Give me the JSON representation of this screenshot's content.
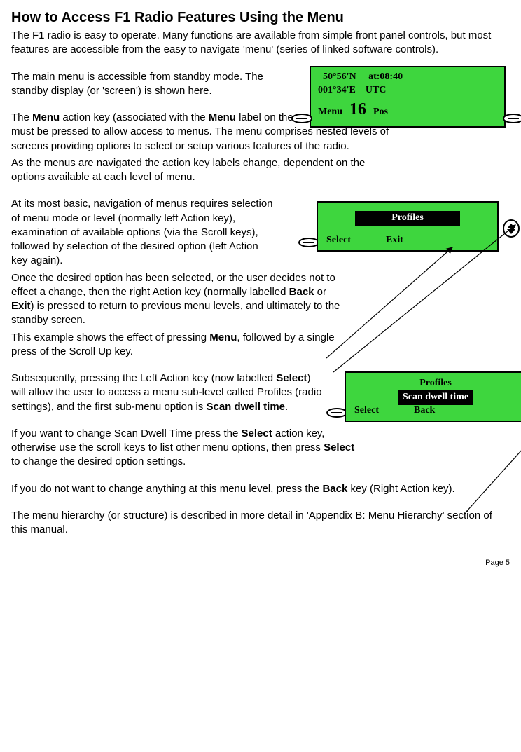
{
  "title": "How to Access F1 Radio Features Using the Menu",
  "intro": "The F1 radio is easy to operate. Many functions are available from simple front panel controls, but most features are accessible from the easy to navigate 'menu' (series of linked software controls).",
  "p1": "The main menu is accessible from standby mode. The standby display (or 'screen') is shown here.",
  "p2a": "The ",
  "p2b_bold": "Menu",
  "p2c": " action key (associated with the ",
  "p2d_bold": "Menu",
  "p2e": " label on the standby screen) must be pressed to allow access to menus. The menu comprises nested levels of screens providing options to select or setup various features of the radio.",
  "p3": "As the menus are navigated the action key labels change, dependent on the options available at each level of menu.",
  "p4": "At its most basic, navigation of menus requires selection of menu mode or level (normally left Action key), examination of available options (via the Scroll keys), followed by selection of the desired option (left Action key again).",
  "p5a": "Once the desired option has been selected, or the user decides not to effect a change, then the right Action key (normally labelled ",
  "p5b_bold": "Back",
  "p5c": " or ",
  "p5d_bold": "Exit",
  "p5e": ") is pressed to return to previous menu levels, and ultimately to the standby screen.",
  "p6a": "This example shows the effect of pressing ",
  "p6b_bold": "Menu",
  "p6c": ", followed by a single press of the Scroll Up key.",
  "p7a": "Subsequently, pressing the Left Action key (now labelled ",
  "p7b_bold": "Select",
  "p7c": ") will allow the user to access a menu sub-level called Profiles (radio settings), and the first sub-menu option is ",
  "p7d_bold": "Scan dwell time",
  "p7e": ".",
  "p8a": "If you want to change Scan Dwell Time press the ",
  "p8b_bold": "Select",
  "p8c": " action key, otherwise use the scroll keys to list other menu options, then press ",
  "p8d_bold": "Select",
  "p8e": " to change the desired option settings.",
  "p9a": "If you do not want to change anything at this menu level, press the ",
  "p9b_bold": "Back",
  "p9c": " key (Right Action key).",
  "p10": "The menu hierarchy (or structure) is described in more detail in 'Appendix B: Menu Hierarchy' section of this manual.",
  "footer": "Page 5",
  "lcd1": {
    "lat": "50°56'N",
    "time_label": "at:08:40",
    "lon": "001°34'E",
    "utc": "UTC",
    "menu": "Menu",
    "ch": "16",
    "pos": "Pos"
  },
  "lcd2": {
    "item": "Profiles",
    "left": "Select",
    "right": "Exit"
  },
  "lcd3": {
    "header": "Profiles",
    "item": "Scan dwell time",
    "left": "Select",
    "right": "Back"
  }
}
